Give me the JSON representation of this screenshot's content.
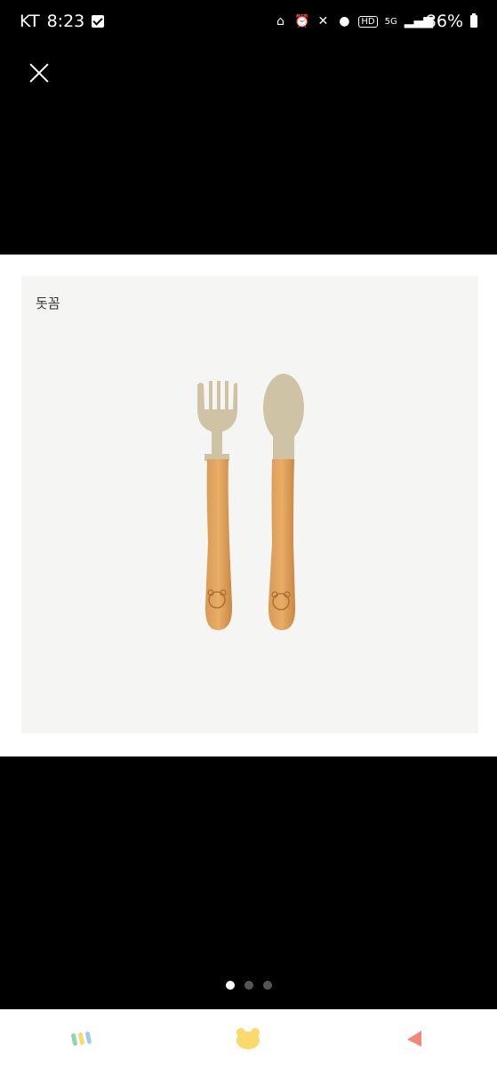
{
  "status_bar": {
    "carrier": "KT",
    "time": "8:23",
    "network": "5G",
    "hd_label": "HD",
    "battery": "86%"
  },
  "viewer": {
    "close_icon": "close-icon",
    "brand_text": "돗꼼",
    "product": "fork-and-spoon",
    "page_count": 3,
    "current_page": 1
  },
  "bottom_nav": {
    "tabs": [
      {
        "icon": "stripes-icon",
        "color": "#8ed6b4"
      },
      {
        "icon": "bear-icon",
        "color": "#fbd96a"
      },
      {
        "icon": "triangle-icon",
        "color": "#f3877a"
      }
    ]
  }
}
